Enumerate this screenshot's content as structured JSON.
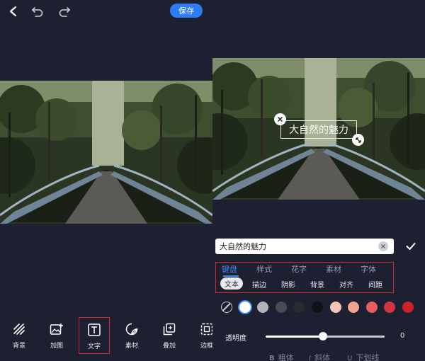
{
  "header": {
    "save_label": "保存"
  },
  "toolbar": {
    "items": [
      {
        "label": "背景",
        "icon": "hatch-background-icon"
      },
      {
        "label": "加图",
        "icon": "add-image-icon"
      },
      {
        "label": "文字",
        "icon": "text-icon"
      },
      {
        "label": "素材",
        "icon": "sticker-icon"
      },
      {
        "label": "叠加",
        "icon": "overlay-icon"
      },
      {
        "label": "边框",
        "icon": "border-icon"
      }
    ],
    "active": "文字"
  },
  "canvas": {
    "overlay_text": "大自然的魅力"
  },
  "text_editor": {
    "input_value": "大自然的魅力",
    "tabs": [
      "键盘",
      "样式",
      "花字",
      "素材",
      "字体"
    ],
    "active_tab": "键盘",
    "subtabs": [
      "文本",
      "描边",
      "阴影",
      "背景",
      "对齐",
      "间距"
    ],
    "active_subtab": "文本",
    "colors": [
      "none",
      "#ffffff",
      "#b3b4ba",
      "#4a4b52",
      "#2a2b31",
      "#101114",
      "#f7c3b6",
      "#f0a391",
      "#e85f62",
      "#d3343f",
      "#cc2329"
    ],
    "selected_color": "#ffffff",
    "opacity_label": "透明度",
    "opacity_value": "0",
    "opacity_fill": 0.48,
    "format": [
      {
        "letter": "B",
        "label": "粗体"
      },
      {
        "letter": "I",
        "label": "斜体"
      },
      {
        "letter": "U",
        "label": "下划线"
      }
    ]
  }
}
